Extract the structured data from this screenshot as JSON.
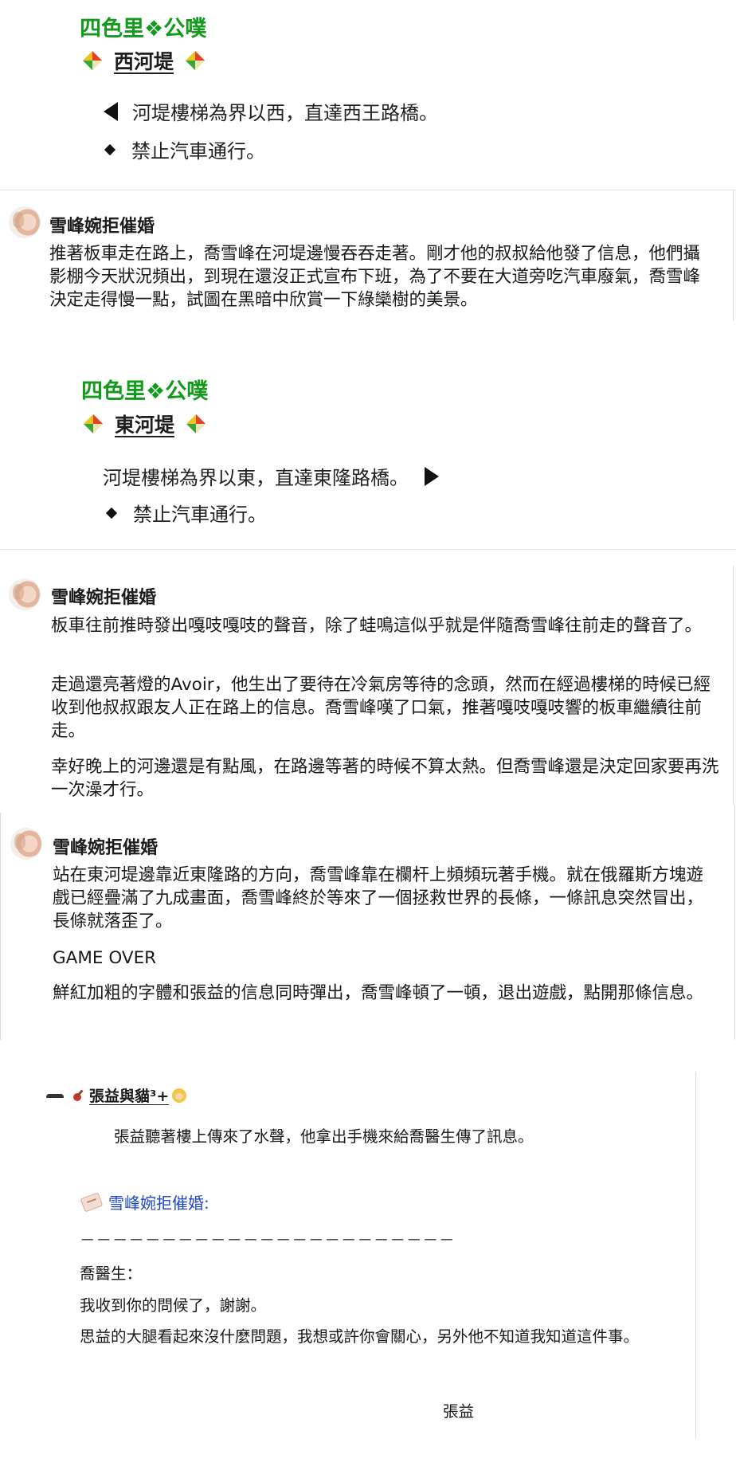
{
  "notice1": {
    "title": "四色里❖公噗",
    "place": "西河堤",
    "line1": "河堤樓梯為界以西，直達西王路橋。",
    "line2": "禁止汽車通行。"
  },
  "post1": {
    "author": "雪峰婉拒催婚",
    "paragraphs": [
      "推著板車走在路上，喬雪峰在河堤邊慢吞吞走著。剛才他的叔叔給他發了信息，他們攝影棚今天狀況頻出，到現在還沒正式宣布下班，為了不要在大道旁吃汽車廢氣，喬雪峰決定走得慢一點，試圖在黑暗中欣賞一下綠欒樹的美景。"
    ]
  },
  "notice2": {
    "title": "四色里❖公噗",
    "place": "東河堤",
    "line1": "河堤樓梯為界以東，直達東隆路橋。",
    "line2": "禁止汽車通行。"
  },
  "post2": {
    "author": "雪峰婉拒催婚",
    "paragraphs": [
      "板車往前推時發出嘎吱嘎吱的聲音，除了蛙鳴這似乎就是伴隨喬雪峰往前走的聲音了。",
      "走過還亮著燈的Avoir，他生出了要待在冷氣房等待的念頭，然而在經過樓梯的時候已經收到他叔叔跟友人正在路上的信息。喬雪峰嘆了口氣，推著嘎吱嘎吱響的板車繼續往前走。",
      "幸好晚上的河邊還是有點風，在路邊等著的時候不算太熱。但喬雪峰還是決定回家要再洗一次澡才行。"
    ]
  },
  "post3": {
    "author": "雪峰婉拒催婚",
    "paragraphs": [
      "站在東河堤邊靠近東隆路的方向，喬雪峰靠在欄杆上頻頻玩著手機。就在俄羅斯方塊遊戲已經疊滿了九成畫面，喬雪峰終於等來了一個拯救世界的長條，一條訊息突然冒出，長條就落歪了。",
      "GAME OVER",
      "鮮紅加粗的字體和張益的信息同時彈出，喬雪峰頓了一頓，退出遊戲，點開那條信息。"
    ]
  },
  "embed": {
    "author": "張益與貓³+",
    "intro": "張益聽著樓上傳來了水聲，他拿出手機來給喬醫生傳了訊息。",
    "mention": "雪峰婉拒催婚:",
    "divider": "－－－－－－－－－－－－－－－－－－－－－－－",
    "salutation": "喬醫生：",
    "line1": "我收到你的問候了，謝謝。",
    "line2": "思益的大腿看起來沒什麼問題，我想或許你會關心，另外他不知道我知道這件事。",
    "signature": "張益"
  },
  "colors": {
    "notice_title": "#129a1b",
    "mention": "#1f47c8"
  }
}
